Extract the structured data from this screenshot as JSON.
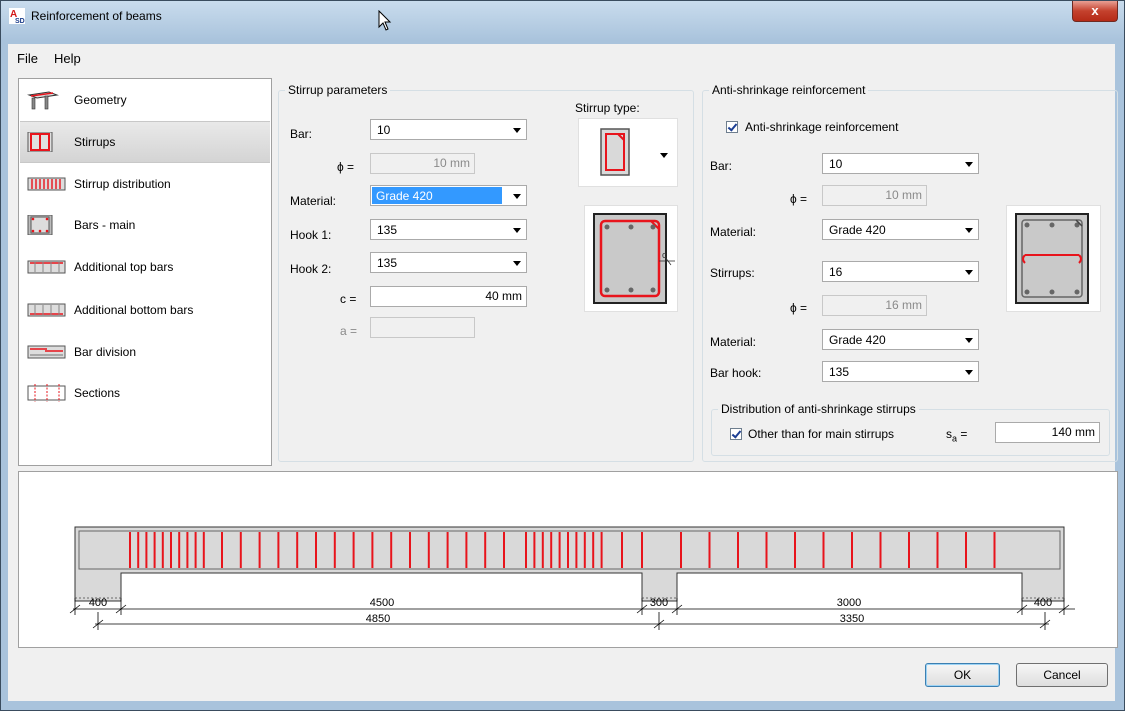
{
  "window": {
    "title": "Reinforcement of beams",
    "close_label": "x"
  },
  "menu": {
    "file": "File",
    "help": "Help"
  },
  "nav": [
    {
      "label": "Geometry",
      "icon": "geometry-icon",
      "selected": false
    },
    {
      "label": "Stirrups",
      "icon": "stirrups-icon",
      "selected": true
    },
    {
      "label": "Stirrup distribution",
      "icon": "stirrup-distribution-icon",
      "selected": false
    },
    {
      "label": "Bars - main",
      "icon": "bars-main-icon",
      "selected": false
    },
    {
      "label": "Additional top bars",
      "icon": "additional-top-bars-icon",
      "selected": false
    },
    {
      "label": "Additional bottom bars",
      "icon": "additional-bottom-bars-icon",
      "selected": false
    },
    {
      "label": "Bar division",
      "icon": "bar-division-icon",
      "selected": false
    },
    {
      "label": "Sections",
      "icon": "sections-icon",
      "selected": false
    }
  ],
  "stirrup": {
    "title": "Stirrup parameters",
    "bar_label": "Bar:",
    "bar_value": "10",
    "phi_label": "ϕ =",
    "phi_value": "10 mm",
    "material_label": "Material:",
    "material_value": "Grade 420",
    "hook1_label": "Hook 1:",
    "hook1_value": "135",
    "hook2_label": "Hook 2:",
    "hook2_value": "135",
    "c_label": "c =",
    "c_value": "40 mm",
    "a_label": "a =",
    "a_value": "",
    "type_label": "Stirrup type:",
    "section_c_label": "c"
  },
  "anti": {
    "title": "Anti-shrinkage reinforcement",
    "checkbox_label": "Anti-shrinkage reinforcement",
    "checked": true,
    "bar_label": "Bar:",
    "bar_value": "10",
    "phi1_label": "ϕ =",
    "phi1_value": "10 mm",
    "material1_label": "Material:",
    "material1_value": "Grade 420",
    "stirrups_label": "Stirrups:",
    "stirrups_value": "16",
    "phi2_label": "ϕ =",
    "phi2_value": "16 mm",
    "material2_label": "Material:",
    "material2_value": "Grade 420",
    "hook_label": "Bar hook:",
    "hook_value": "135",
    "dist_title": "Distribution of anti-shrinkage stirrups",
    "dist_checkbox_label": "Other than for main stirrups",
    "dist_checked": true,
    "sa_label": "s",
    "sa_sub": "a",
    "sa_eq": "=",
    "sa_value": "140 mm"
  },
  "beam": {
    "dims_top": [
      "400",
      "4500",
      "300",
      "3000",
      "400"
    ],
    "dims_bottom": [
      "4850",
      "3350"
    ]
  },
  "buttons": {
    "ok": "OK",
    "cancel": "Cancel"
  },
  "colors": {
    "stirrup_red": "#e8141c",
    "selection_blue": "#3399ff"
  }
}
